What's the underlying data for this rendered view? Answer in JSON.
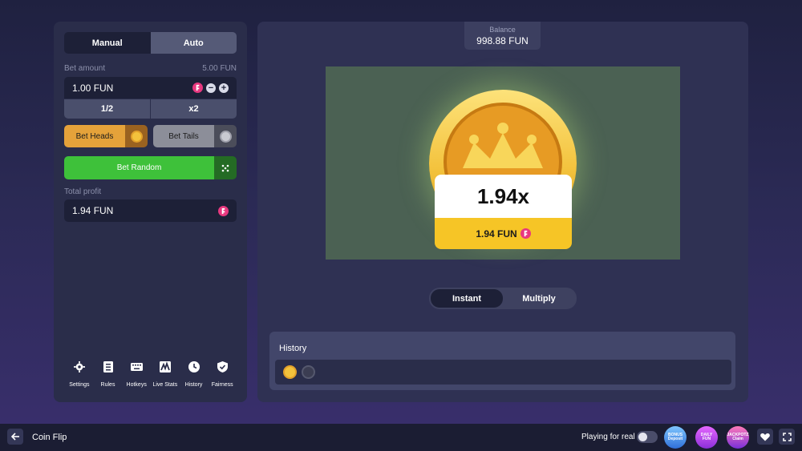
{
  "colors": {
    "accent_green": "#3ec13a",
    "heads_orange": "#e5a23a",
    "tails_gray": "#8c8e99",
    "fun_pink": "#e8387f",
    "coin_gold": "#f3c23c"
  },
  "left": {
    "tabs": [
      {
        "label": "Manual",
        "active": true
      },
      {
        "label": "Auto",
        "active": false
      }
    ],
    "bet_amount_label": "Bet amount",
    "bet_amount_max": "5.00 FUN",
    "bet_amount_value": "1.00 FUN",
    "minus_label": "−",
    "plus_label": "+",
    "half_label": "1/2",
    "double_label": "x2",
    "bet_heads_label": "Bet Heads",
    "bet_tails_label": "Bet Tails",
    "bet_random_label": "Bet Random",
    "total_profit_label": "Total profit",
    "total_profit_value": "1.94 FUN",
    "footer": [
      {
        "label": "Settings",
        "icon": "gear-icon"
      },
      {
        "label": "Rules",
        "icon": "document-icon"
      },
      {
        "label": "Hotkeys",
        "icon": "keyboard-icon"
      },
      {
        "label": "Live Stats",
        "icon": "chart-icon"
      },
      {
        "label": "History",
        "icon": "clock-icon"
      },
      {
        "label": "Fairness",
        "icon": "shield-icon"
      }
    ]
  },
  "balance": {
    "title": "Balance",
    "value": "998.88 FUN"
  },
  "result": {
    "multiplier": "1.94x",
    "payout": "1.94 FUN"
  },
  "modes": [
    {
      "label": "Instant",
      "active": true
    },
    {
      "label": "Multiply",
      "active": false
    }
  ],
  "history": {
    "title": "History",
    "items": [
      "heads",
      "tails"
    ]
  },
  "bottom": {
    "game_title": "Coin Flip",
    "playing_for_real_label": "Playing for real",
    "playing_for_real_on": false,
    "promos": [
      {
        "top": "BONUS",
        "bottom": "Deposit"
      },
      {
        "top": "DAILY",
        "bottom": "FUN"
      },
      {
        "top": "JACKPOTZ",
        "bottom": "Claim"
      }
    ]
  }
}
